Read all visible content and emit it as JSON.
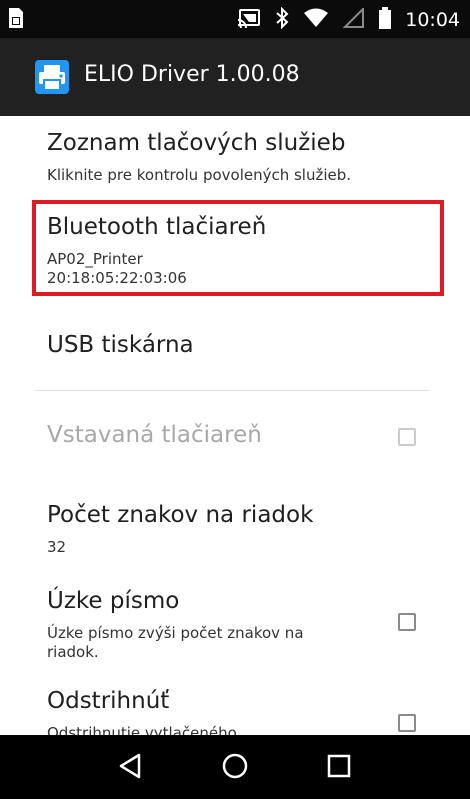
{
  "status_bar": {
    "time": "10:04",
    "icons": [
      "sim-icon",
      "cast-icon",
      "bluetooth-icon",
      "wifi-icon",
      "signal-icon",
      "battery-icon"
    ]
  },
  "action_bar": {
    "app_icon": "printer-icon",
    "title": "ELIO Driver 1.00.08"
  },
  "preferences": {
    "services": {
      "title": "Zoznam tlačových služieb",
      "summary": "Kliknite pre kontrolu povolených služieb."
    },
    "bluetooth": {
      "title": "Bluetooth tlačiareň",
      "summary_line1": "AP02_Printer",
      "summary_line2": "20:18:05:22:03:06"
    },
    "usb": {
      "title": "USB tiskárna"
    },
    "builtin": {
      "title": "Vstavaná tlačiareň",
      "checked": false,
      "enabled": false
    },
    "chars_per_line": {
      "title": "Počet znakov na riadok",
      "summary": "32"
    },
    "narrow_font": {
      "title": "Úzke písmo",
      "summary_line1": "Úzke písmo zvýši počet znakov na",
      "summary_line2": "riadok.",
      "checked": false
    },
    "cut": {
      "title": "Odstrihnúť",
      "summary_line1": "Odstrihnutie vytlačeného",
      "checked": false
    }
  },
  "highlight_color": "#e01b24",
  "nav_bar": {
    "buttons": [
      "back-icon",
      "home-icon",
      "recents-icon"
    ]
  }
}
